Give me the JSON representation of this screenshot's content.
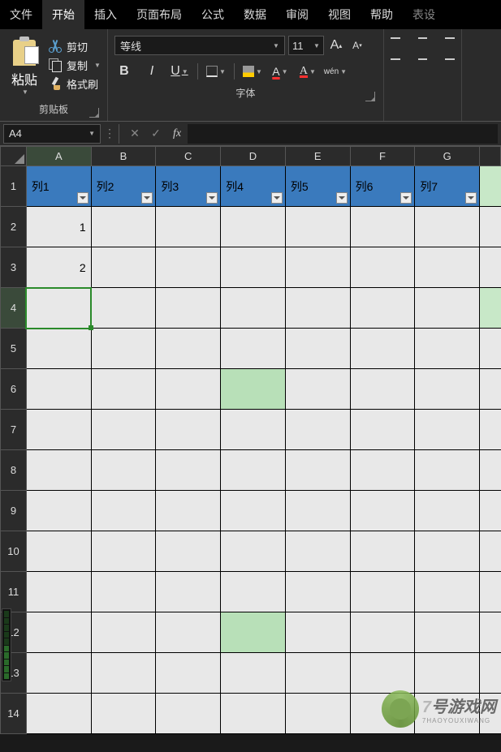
{
  "tabs": {
    "file": "文件",
    "home": "开始",
    "insert": "插入",
    "layout": "页面布局",
    "formula": "公式",
    "data": "数据",
    "review": "审阅",
    "view": "视图",
    "help": "帮助",
    "table": "表设"
  },
  "ribbon": {
    "clipboard": {
      "paste": "粘贴",
      "cut": "剪切",
      "copy": "复制",
      "format_painter": "格式刷",
      "group_label": "剪贴板"
    },
    "font": {
      "family": "等线",
      "size": "11",
      "grow": "A",
      "shrink": "A",
      "bold": "B",
      "italic": "I",
      "underline": "U",
      "font_color_letter": "A",
      "accent_letter": "A",
      "ruby": "wén",
      "group_label": "字体"
    }
  },
  "formula_bar": {
    "cell_ref": "A4",
    "fx": "fx"
  },
  "columns": [
    "A",
    "B",
    "C",
    "D",
    "E",
    "F",
    "G"
  ],
  "rows": [
    "1",
    "2",
    "3",
    "4",
    "5",
    "6",
    "7",
    "8",
    "9",
    "10",
    "11",
    "12",
    "13",
    "14"
  ],
  "table_headers": [
    "列1",
    "列2",
    "列3",
    "列4",
    "列5",
    "列6",
    "列7"
  ],
  "cells": {
    "A2": "1",
    "A3": "2"
  },
  "watermark": {
    "num": "7",
    "text": "号游戏网",
    "sub": "7HAOYOUXIWANG"
  }
}
